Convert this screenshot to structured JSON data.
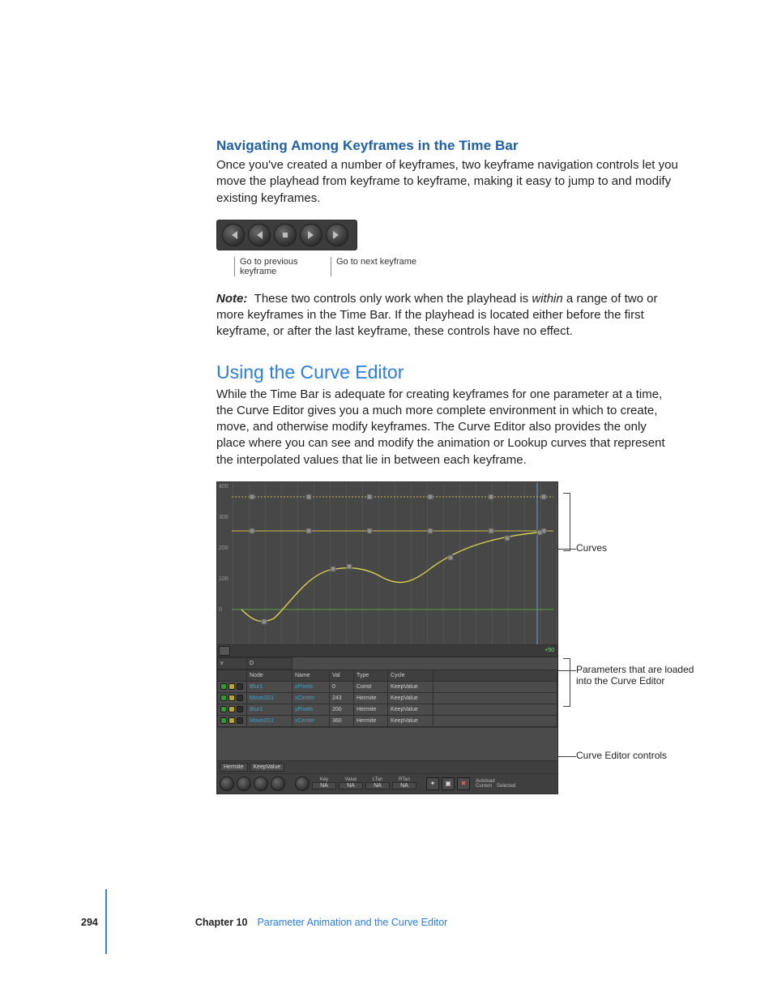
{
  "section1": {
    "heading": "Navigating Among Keyframes in the Time Bar",
    "para": "Once you've created a number of keyframes, two keyframe navigation controls let you move the playhead from keyframe to keyframe, making it easy to jump to and modify existing keyframes.",
    "caption_prev": "Go to previous keyframe",
    "caption_next": "Go to next keyframe",
    "note_label": "Note:",
    "note_before": "These two controls only work when the playhead is",
    "note_within": "within",
    "note_after": "a range of two or more keyframes in the Time Bar. If the playhead is located either before the first keyframe, or after the last keyframe, these controls have no effect."
  },
  "section2": {
    "heading": "Using the Curve Editor",
    "para": "While the Time Bar is adequate for creating keyframes for one parameter at a time, the Curve Editor gives you a much more complete environment in which to create, move, and otherwise modify keyframes. The Curve Editor also provides the only place where you can see and modify the animation or Lookup curves that represent the interpolated values that lie in between each keyframe."
  },
  "curve_editor": {
    "y_ticks": [
      "400",
      "300",
      "200",
      "100",
      "0"
    ],
    "time_readout": "+50",
    "headers": [
      "v",
      "D",
      "Node",
      "Name",
      "Val",
      "Type",
      "Cycle"
    ],
    "rows": [
      {
        "node": "Blur1",
        "name": "xPixels",
        "val": "0",
        "type": "Const",
        "cycle": "KeepValue"
      },
      {
        "node": "Move2D1",
        "name": "xCenter",
        "val": "243",
        "type": "Hermite",
        "cycle": "KeepValue"
      },
      {
        "node": "Blur1",
        "name": "yPixels",
        "val": "200",
        "type": "Hermite",
        "cycle": "KeepValue"
      },
      {
        "node": "Move2D1",
        "name": "xCenter",
        "val": "360",
        "type": "Hermite",
        "cycle": "KeepValue"
      }
    ],
    "footer1": {
      "chip1": "Hermite",
      "chip2": "KeepValue"
    },
    "footer2": {
      "fields": [
        {
          "lab": "Key",
          "val": "NA"
        },
        {
          "lab": "Value",
          "val": "NA"
        },
        {
          "lab": "LTan",
          "val": "NA"
        },
        {
          "lab": "RTan",
          "val": "NA"
        }
      ],
      "autoload_label": "Autoload",
      "autoload_opts": [
        "Current",
        "Selected"
      ]
    },
    "callouts": {
      "curves": "Curves",
      "params": "Parameters that are loaded into the Curve Editor",
      "controls": "Curve Editor controls"
    }
  },
  "chart_data": {
    "type": "line",
    "title": "",
    "xlabel": "",
    "ylabel": "",
    "ylim": [
      -50,
      400
    ],
    "x_range": [
      1,
      50
    ],
    "series": [
      {
        "name": "Blur1.xPixels (Const)",
        "values_y": 360,
        "display": "flat"
      },
      {
        "name": "Move2D1.xCenter (Hermite flat)",
        "values_y": 280,
        "display": "flat"
      },
      {
        "name": "Blur1.yPixels (Hermite flat)",
        "values_y": 0,
        "display": "flat"
      },
      {
        "name": "Move2D1.xCenter (Hermite curve)",
        "display": "curve",
        "points": [
          {
            "x": 1,
            "y": 0
          },
          {
            "x": 6,
            "y": -25
          },
          {
            "x": 12,
            "y": 80
          },
          {
            "x": 18,
            "y": 135
          },
          {
            "x": 22,
            "y": 138
          },
          {
            "x": 27,
            "y": 120
          },
          {
            "x": 33,
            "y": 160
          },
          {
            "x": 40,
            "y": 210
          },
          {
            "x": 46,
            "y": 235
          },
          {
            "x": 50,
            "y": 243
          }
        ]
      }
    ]
  },
  "footer": {
    "page_number": "294",
    "chapter": "Chapter 10",
    "chapter_title": "Parameter Animation and the Curve Editor"
  }
}
